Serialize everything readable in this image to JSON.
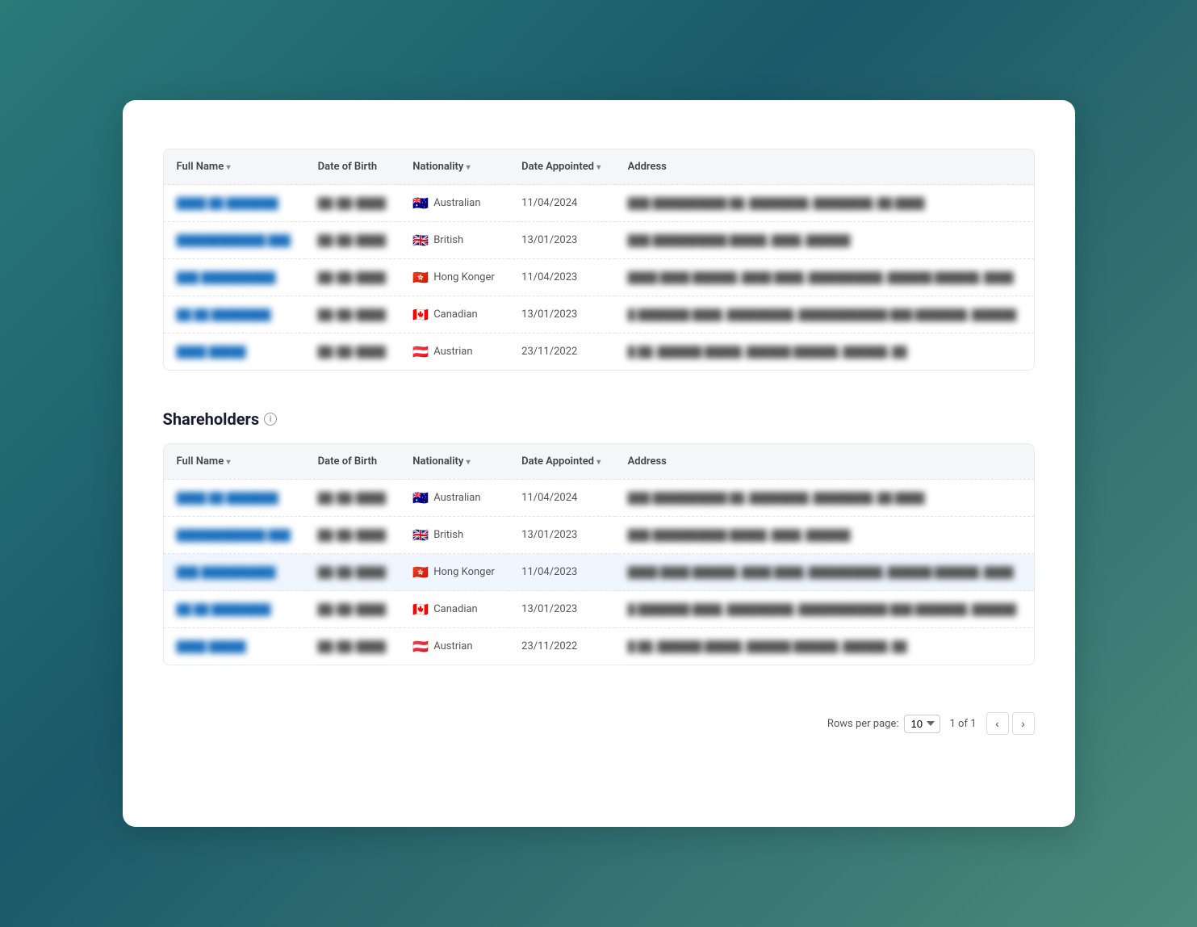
{
  "card": {
    "sections": [
      {
        "id": "directors",
        "title": "",
        "showTitle": false
      },
      {
        "id": "shareholders",
        "title": "Shareholders",
        "showTitle": true
      }
    ]
  },
  "tableHeaders": {
    "fullName": "Full Name",
    "dateOfBirth": "Date of Birth",
    "nationality": "Nationality",
    "dateAppointed": "Date Appointed",
    "address": "Address"
  },
  "tables": {
    "directors": [
      {
        "name": "████ ██ ███████",
        "dob": "██/██/████",
        "nationalityFlag": "🇦🇺",
        "nationality": "Australian",
        "dateAppointed": "11/04/2024",
        "address": "███ ██████████ ██, ████████, ████████, ██ ████"
      },
      {
        "name": "████████████ ███",
        "dob": "██/██/████",
        "nationalityFlag": "🇬🇧",
        "nationality": "British",
        "dateAppointed": "13/01/2023",
        "address": "███ ██████████ █████, ████, ██████"
      },
      {
        "name": "███ ██████████",
        "dob": "██/██/████",
        "nationalityFlag": "🇭🇰",
        "nationality": "Hong Konger",
        "dateAppointed": "11/04/2023",
        "address": "████ ████ ██████, ████ ████, ██████████, ██████ ██████, ████"
      },
      {
        "name": "██ ██ ████████",
        "dob": "██/██/████",
        "nationalityFlag": "🇨🇦",
        "nationality": "Canadian",
        "dateAppointed": "13/01/2023",
        "address": "█ ███████ ████, █████████, ████████████ ███ ███████, ██████"
      },
      {
        "name": "████ █████",
        "dob": "██/██/████",
        "nationalityFlag": "🇦🇹",
        "nationality": "Austrian",
        "dateAppointed": "23/11/2022",
        "address": "█ ██, ██████ █████, ██████ ██████, ██████, ██"
      }
    ],
    "shareholders": [
      {
        "name": "████ ██ ███████",
        "dob": "██/██/████",
        "nationalityFlag": "🇦🇺",
        "nationality": "Australian",
        "dateAppointed": "11/04/2024",
        "address": "███ ██████████ ██, ████████, ████████, ██ ████"
      },
      {
        "name": "████████████ ███",
        "dob": "██/██/████",
        "nationalityFlag": "🇬🇧",
        "nationality": "British",
        "dateAppointed": "13/01/2023",
        "address": "███ ██████████ █████, ████, ██████"
      },
      {
        "name": "███ ██████████",
        "dob": "██/██/████",
        "nationalityFlag": "🇭🇰",
        "nationality": "Hong Konger",
        "dateAppointed": "11/04/2023",
        "address": "████ ████ ██████, ████ ████, ██████████, ██████ ██████, ████",
        "highlighted": true
      },
      {
        "name": "██ ██ ████████",
        "dob": "██/██/████",
        "nationalityFlag": "🇨🇦",
        "nationality": "Canadian",
        "dateAppointed": "13/01/2023",
        "address": "█ ███████ ████, █████████, ████████████ ███ ███████, ██████"
      },
      {
        "name": "████ █████",
        "dob": "██/██/████",
        "nationalityFlag": "🇦🇹",
        "nationality": "Austrian",
        "dateAppointed": "23/11/2022",
        "address": "█ ██, ██████ █████, ██████ ██████, ██████, ██"
      }
    ]
  },
  "pagination": {
    "rowsPerPageLabel": "Rows per page:",
    "rowsPerPageValue": "10",
    "pageInfo": "1 of 1"
  },
  "icons": {
    "info": "i",
    "chevronLeft": "‹",
    "chevronRight": "›",
    "dropdownArrow": "▾"
  }
}
